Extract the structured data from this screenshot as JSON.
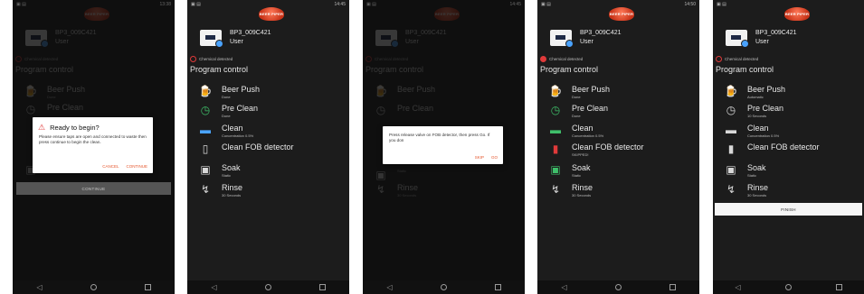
{
  "logo": {
    "text": "BEER PIPER"
  },
  "device": {
    "id": "BP3_009C421",
    "role": "User"
  },
  "chemical_label": "Chemical detected",
  "program_title": "Program control",
  "step_names": {
    "beer": "Beer Push",
    "pre": "Pre Clean",
    "clean": "Clean",
    "fob": "Clean FOB detector",
    "soak": "Soak",
    "rinse": "Rinse"
  },
  "screens": [
    {
      "status_time": "13:38",
      "steps": {
        "beer": "Done",
        "pre": "",
        "clean": "",
        "fob": "",
        "soak": "1 Minute",
        "rinse": ""
      },
      "dialog": {
        "title": "Ready to begin?",
        "body": "Please ensure taps are open and connected to waste then press continue to begin the clean.",
        "cancel": "CANCEL",
        "confirm": "CONTINUE"
      },
      "button": "CONTINUE"
    },
    {
      "status_time": "14:45",
      "steps": {
        "beer": "Done",
        "pre": "Done",
        "clean": "Concentration 0.5%",
        "fob": "",
        "soak": "Static",
        "rinse": "30 Seconds"
      }
    },
    {
      "status_time": "14:45",
      "steps": {
        "beer": "",
        "pre": "",
        "clean": "",
        "fob": "",
        "soak": "Static",
        "rinse": "30 Seconds"
      },
      "dialog": {
        "body": "Press release valve on FOB detector, then press Go. If you don",
        "skip": "SKIP",
        "go": "GO"
      }
    },
    {
      "status_time": "14:50",
      "steps": {
        "beer": "Done",
        "pre": "Done",
        "clean": "Concentration 0.5%",
        "fob": "SKIPPED!",
        "soak": "Static",
        "rinse": "30 Seconds"
      }
    },
    {
      "status_time": "",
      "steps": {
        "beer": "Automatic",
        "pre": "10 Seconds",
        "clean": "Concentration 0.5%",
        "fob": "",
        "soak": "Static",
        "rinse": "30 Seconds"
      },
      "button": "FINISH"
    }
  ],
  "colors": {
    "accent": "#e6572e",
    "green": "#3fbf6a",
    "red": "#e03a3a",
    "blue": "#4aa3ff"
  }
}
